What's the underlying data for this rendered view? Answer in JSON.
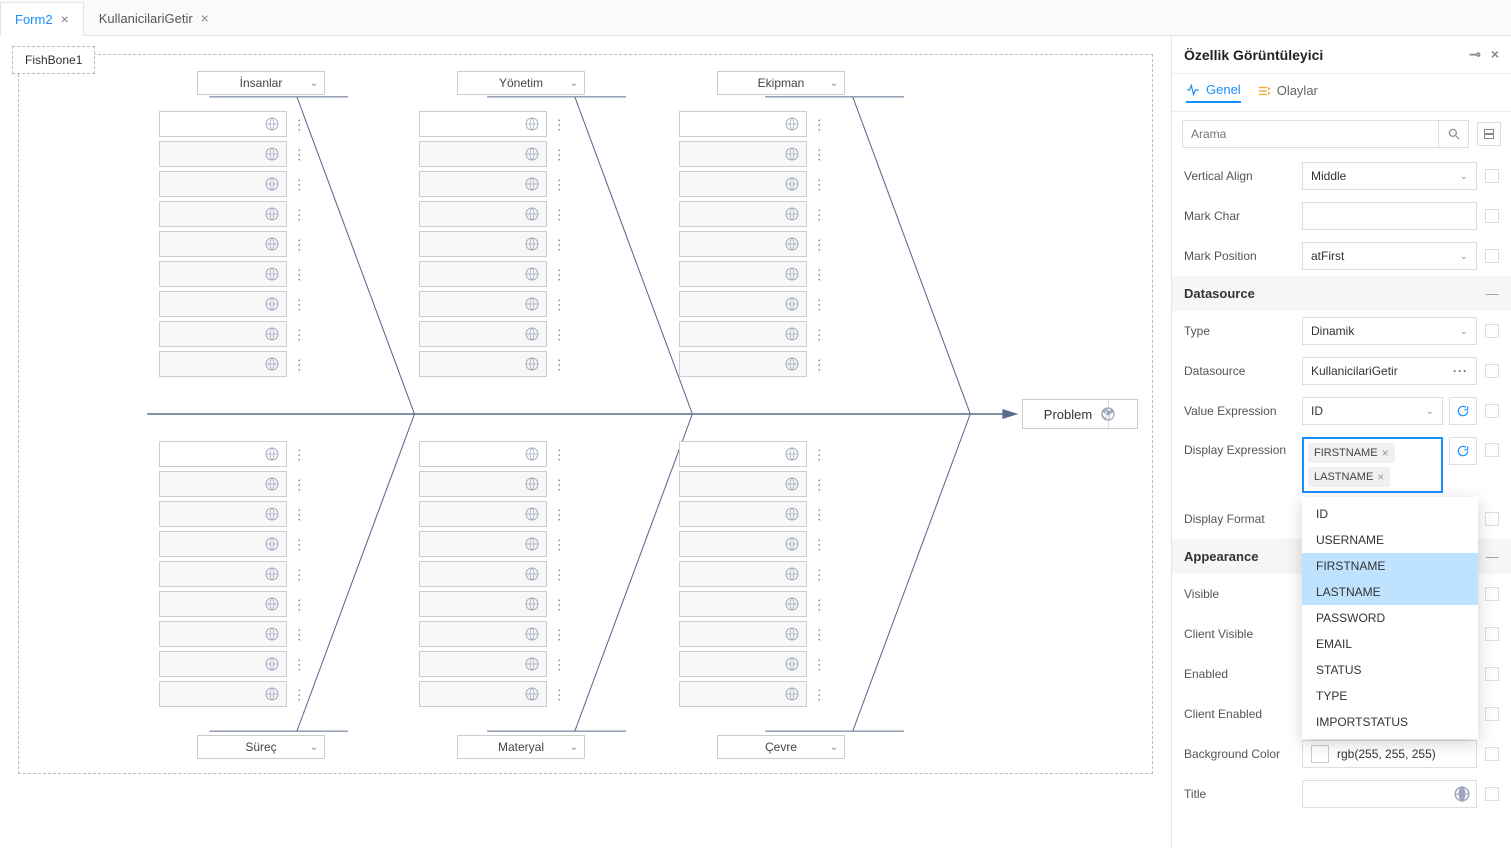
{
  "tabs": [
    {
      "label": "Form2",
      "active": true
    },
    {
      "label": "KullanicilariGetir",
      "active": false
    }
  ],
  "canvas": {
    "component_label": "FishBone1",
    "top_categories": [
      "İnsanlar",
      "Yönetim",
      "Ekipman"
    ],
    "bottom_categories": [
      "Süreç",
      "Materyal",
      "Çevre"
    ],
    "problem_label": "Problem"
  },
  "panel": {
    "title": "Özellik Görüntüleyici",
    "tab_general": "Genel",
    "tab_events": "Olaylar",
    "search_placeholder": "Arama",
    "props": {
      "vertical_align": {
        "label": "Vertical Align",
        "value": "Middle"
      },
      "mark_char": {
        "label": "Mark Char",
        "value": ""
      },
      "mark_position": {
        "label": "Mark Position",
        "value": "atFirst"
      },
      "section_datasource": "Datasource",
      "type": {
        "label": "Type",
        "value": "Dinamik"
      },
      "datasource": {
        "label": "Datasource",
        "value": "KullanicilariGetir"
      },
      "value_expression": {
        "label": "Value Expression",
        "value": "ID"
      },
      "display_expression": {
        "label": "Display Expression",
        "chips": [
          "FIRSTNAME",
          "LASTNAME"
        ],
        "options": [
          "ID",
          "USERNAME",
          "FIRSTNAME",
          "LASTNAME",
          "PASSWORD",
          "EMAIL",
          "STATUS",
          "TYPE",
          "IMPORTSTATUS"
        ],
        "selected": [
          "FIRSTNAME",
          "LASTNAME"
        ]
      },
      "display_format": {
        "label": "Display Format",
        "value": ""
      },
      "section_appearance": "Appearance",
      "visible": {
        "label": "Visible"
      },
      "client_visible": {
        "label": "Client Visible"
      },
      "enabled": {
        "label": "Enabled"
      },
      "client_enabled": {
        "label": "Client Enabled"
      },
      "background_color": {
        "label": "Background Color",
        "value": "rgb(255, 255, 255)"
      },
      "title": {
        "label": "Title",
        "value": ""
      }
    }
  }
}
